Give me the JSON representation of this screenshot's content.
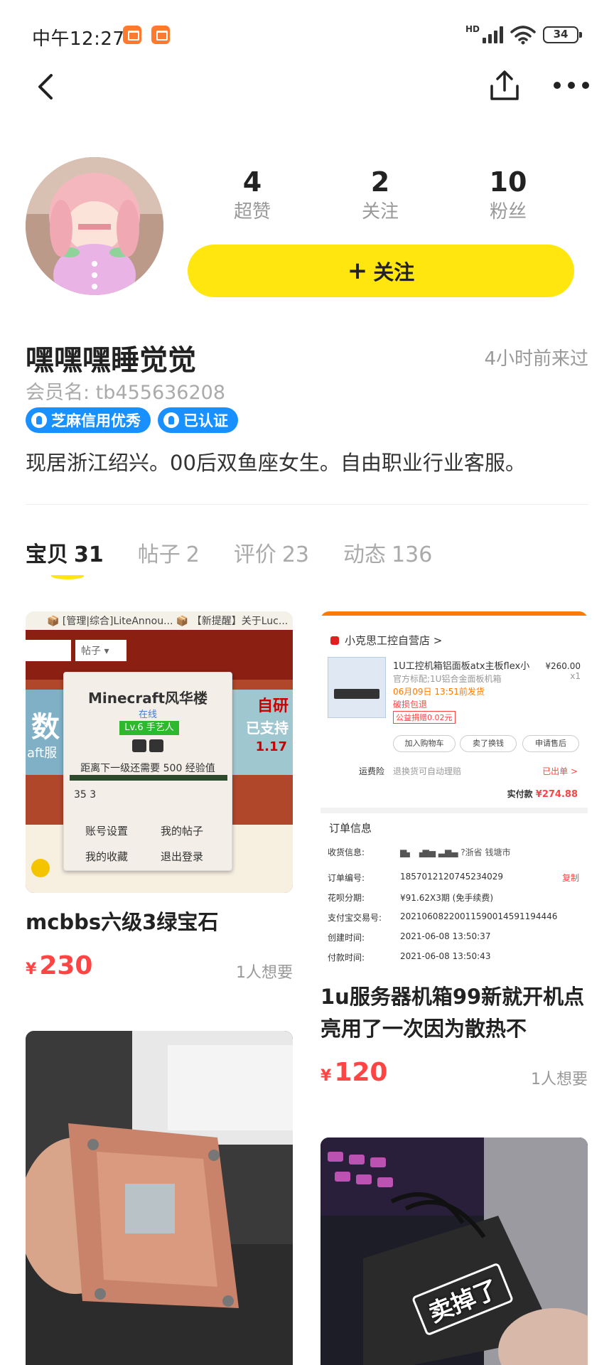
{
  "status_bar": {
    "time": "中午12:27",
    "network": "HD",
    "battery": "34"
  },
  "profile": {
    "stats": [
      {
        "value": "4",
        "label": "超赞"
      },
      {
        "value": "2",
        "label": "关注"
      },
      {
        "value": "10",
        "label": "粉丝"
      }
    ],
    "follow_label": "关注",
    "name": "嘿嘿嘿睡觉觉",
    "last_seen": "4小时前来过",
    "member_id": "会员名: tb455636208",
    "badges": [
      "芝麻信用优秀",
      "已认证"
    ],
    "bio": "现居浙江绍兴。00后双鱼座女生。自由职业行业客服。"
  },
  "tabs": [
    {
      "label": "宝贝",
      "count": "31",
      "active": true
    },
    {
      "label": "帖子",
      "count": "2",
      "active": false
    },
    {
      "label": "评价",
      "count": "23",
      "active": false
    },
    {
      "label": "动态",
      "count": "136",
      "active": false
    }
  ],
  "items": [
    {
      "title": "mcbbs六级3绿宝石",
      "price_symbol": "¥",
      "price": "230",
      "want": "1人想要",
      "image": {
        "top_bar": "📦 [管理|综合]LiteAnnou...   📦 【新提醒】关于Luc...",
        "select": "帖子 ▾",
        "pop_title": "Minecraft风华楼",
        "pop_status": "在线",
        "level": "Lv.6 手艺人",
        "exp_text": "距离下一级还需要 500 经验值",
        "gems": "35    3",
        "menu": [
          "账号设置",
          "我的帖子",
          "我的收藏",
          "退出登录"
        ],
        "side_texts": [
          "自研",
          "已支持",
          "1.17",
          "数",
          "aft服"
        ]
      }
    },
    {
      "title": "1u服务器机箱99新就开机点亮用了一次因为散热不",
      "price_symbol": "¥",
      "price": "120",
      "want": "1人想要",
      "image": {
        "shop": "小克思工控自营店 >",
        "product_title": "1U工控机箱铝面板atx主板flex小",
        "product_price": "¥260.00",
        "product_qty": "x1",
        "product_sub": "官方标配;1U铝合金面板机箱",
        "product_date": "06月09日 13:51前发货",
        "product_tag": "破损包退",
        "product_tag2": "公益捐赠0.02元",
        "buttons": [
          "加入购物车",
          "卖了换钱",
          "申请售后"
        ],
        "ship_label": "运费险",
        "ship_text": "退换货可自动理赔",
        "ship_status": "已出单 >",
        "paid_label": "实付款",
        "paid_value": "¥274.88",
        "info_header": "订单信息",
        "rows": [
          {
            "label": "收货信息:",
            "value": "▆▖ ▗▆▅  ▃▆▄  ?浙省 钱塘市",
            "copy": ""
          },
          {
            "label": "订单编号:",
            "value": "1857012120745234029",
            "copy": "复制"
          },
          {
            "label": "花呗分期:",
            "value": "¥91.62X3期 (免手续费)",
            "copy": ""
          },
          {
            "label": "支付宝交易号:",
            "value": "20210608220011590014591194446",
            "copy": ""
          },
          {
            "label": "创建时间:",
            "value": "2021-06-08 13:50:37",
            "copy": ""
          },
          {
            "label": "付款时间:",
            "value": "2021-06-08 13:50:43",
            "copy": ""
          }
        ]
      }
    },
    {
      "title": "",
      "stamp": "卖掉了"
    }
  ],
  "colors": {
    "accent": "#ffe60f",
    "price": "#ff4444",
    "badge": "#1890ff"
  }
}
